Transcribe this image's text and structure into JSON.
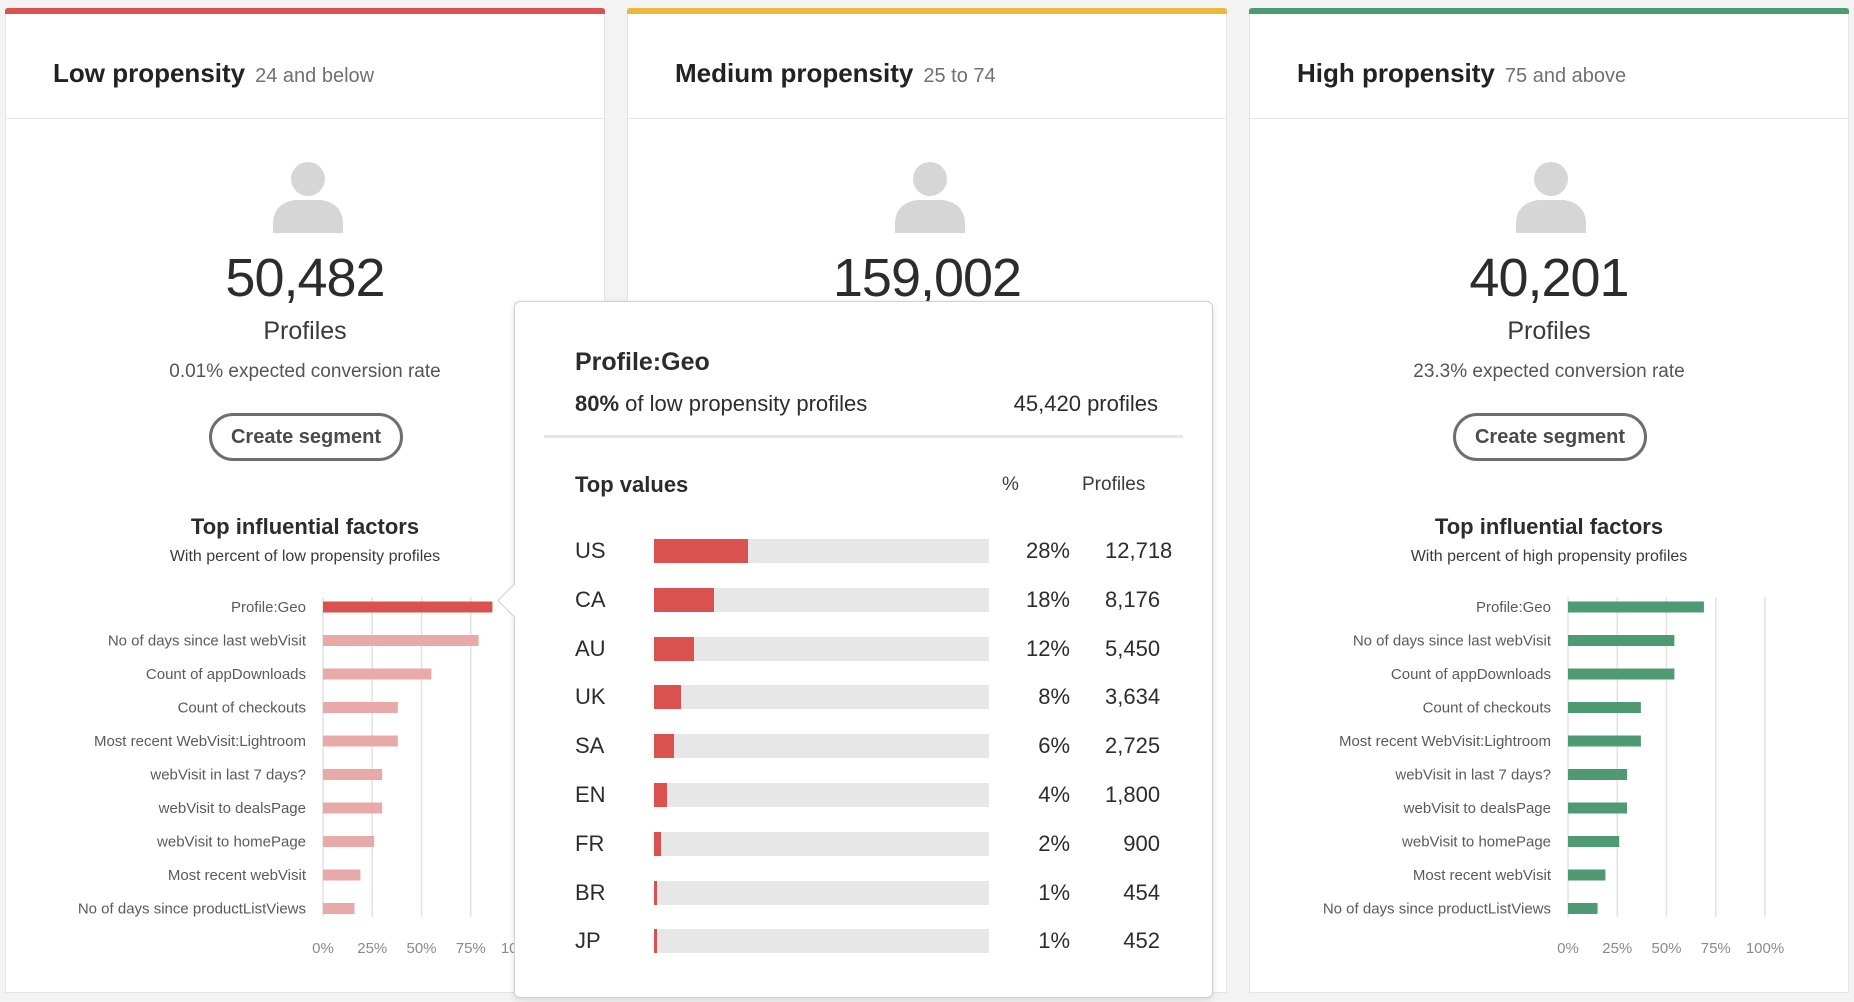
{
  "colors": {
    "low": "#d9524f",
    "low_light": "#e9a9a8",
    "medium": "#efb83c",
    "high": "#4e9a72"
  },
  "cards": {
    "low": {
      "title": "Low propensity",
      "range": "24 and below",
      "count": "50,482",
      "profiles_label": "Profiles",
      "conversion": "0.01% expected conversion rate",
      "button": "Create segment",
      "factors_title": "Top influential factors",
      "factors_subtitle": "With percent of low propensity profiles"
    },
    "medium": {
      "title": "Medium propensity",
      "range": "25 to 74",
      "count": "159,002"
    },
    "high": {
      "title": "High propensity",
      "range": "75 and above",
      "count": "40,201",
      "profiles_label": "Profiles",
      "conversion": "23.3% expected conversion rate",
      "button": "Create segment",
      "factors_title": "Top influential factors",
      "factors_subtitle": "With percent of high propensity profiles"
    }
  },
  "chart_data": [
    {
      "type": "bar",
      "orientation": "horizontal",
      "categories": [
        "Profile:Geo",
        "No of days since last webVisit",
        "Count of appDownloads",
        "Count of checkouts",
        "Most recent WebVisit:Lightroom",
        "webVisit in last 7 days?",
        "webVisit to dealsPage",
        "webVisit to homePage",
        "Most recent webVisit",
        "No of days since productListViews"
      ],
      "values": [
        86,
        79,
        55,
        38,
        38,
        30,
        30,
        26,
        19,
        16
      ],
      "highlighted": "Profile:Geo",
      "xlim": [
        0,
        100
      ],
      "xticks": [
        "0%",
        "25%",
        "50%",
        "75%",
        "100%"
      ],
      "grid": true
    },
    {
      "type": "bar",
      "orientation": "horizontal",
      "categories": [
        "Profile:Geo",
        "No of days since last webVisit",
        "Count of appDownloads",
        "Count of checkouts",
        "Most recent WebVisit:Lightroom",
        "webVisit in last 7 days?",
        "webVisit to dealsPage",
        "webVisit to homePage",
        "Most recent webVisit",
        "No of days since productListViews"
      ],
      "values": [
        69,
        54,
        54,
        37,
        37,
        30,
        30,
        26,
        19,
        15
      ],
      "xlim": [
        0,
        100
      ],
      "xticks": [
        "0%",
        "25%",
        "50%",
        "75%",
        "100%"
      ],
      "grid": true
    }
  ],
  "popover": {
    "title": "Profile:Geo",
    "percent": "80%",
    "percent_suffix": "of low propensity profiles",
    "count": "45,420 profiles",
    "top_values_title": "Top values",
    "col_pct": "%",
    "col_profiles": "Profiles",
    "rows": [
      {
        "code": "US",
        "pct_value": 28,
        "pct": "28%",
        "profiles": "12,718"
      },
      {
        "code": "CA",
        "pct_value": 18,
        "pct": "18%",
        "profiles": "8,176"
      },
      {
        "code": "AU",
        "pct_value": 12,
        "pct": "12%",
        "profiles": "5,450"
      },
      {
        "code": "UK",
        "pct_value": 8,
        "pct": "8%",
        "profiles": "3,634"
      },
      {
        "code": "SA",
        "pct_value": 6,
        "pct": "6%",
        "profiles": "2,725"
      },
      {
        "code": "EN",
        "pct_value": 4,
        "pct": "4%",
        "profiles": "1,800"
      },
      {
        "code": "FR",
        "pct_value": 2,
        "pct": "2%",
        "profiles": "900"
      },
      {
        "code": "BR",
        "pct_value": 1,
        "pct": "1%",
        "profiles": "454"
      },
      {
        "code": "JP",
        "pct_value": 1,
        "pct": "1%",
        "profiles": "452"
      }
    ]
  }
}
